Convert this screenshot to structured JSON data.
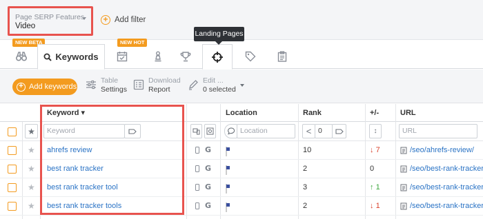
{
  "filters": {
    "serp_label": "Page SERP Features",
    "serp_value": "Video",
    "add_filter": "Add filter"
  },
  "tooltip": "Landing Pages",
  "tabs": {
    "badge_beta": "NEW BETA",
    "badge_hot": "NEW HOT",
    "keywords": "Keywords",
    "icons": [
      "binoculars-icon",
      "calendar-check-icon",
      "chess-pawn-icon",
      "trophy-icon",
      "crosshair-icon",
      "tag-icon",
      "clipboard-icon"
    ]
  },
  "toolbar": {
    "add_keywords": "Add keywords",
    "table_l1": "Table",
    "table_l2": "Settings",
    "download_l1": "Download",
    "download_l2": "Report",
    "edit_l1": "Edit ...",
    "edit_l2": "0 selected"
  },
  "table": {
    "headers": {
      "keyword": "Keyword ▾",
      "location": "Location",
      "rank": "Rank",
      "change": "+/-",
      "url": "URL"
    },
    "placeholders": {
      "keyword": "Keyword",
      "location": "Location",
      "rank": "0",
      "url": "URL"
    },
    "rows": [
      {
        "keyword": "ahrefs review",
        "rank": "10",
        "change": "7",
        "dir": "down",
        "url": "/seo/ahrefs-review/"
      },
      {
        "keyword": "best rank tracker",
        "rank": "2",
        "change": "0",
        "dir": "none",
        "url": "/seo/best-rank-tracker/"
      },
      {
        "keyword": "best rank tracker tool",
        "rank": "3",
        "change": "1",
        "dir": "up",
        "url": "/seo/best-rank-tracker/"
      },
      {
        "keyword": "best rank tracker tools",
        "rank": "2",
        "change": "1",
        "dir": "down",
        "url": "/seo/best-rank-tracker/"
      }
    ]
  },
  "colors": {
    "accent": "#f39b1f",
    "highlight": "#e8534e",
    "link": "#2a73c5"
  }
}
